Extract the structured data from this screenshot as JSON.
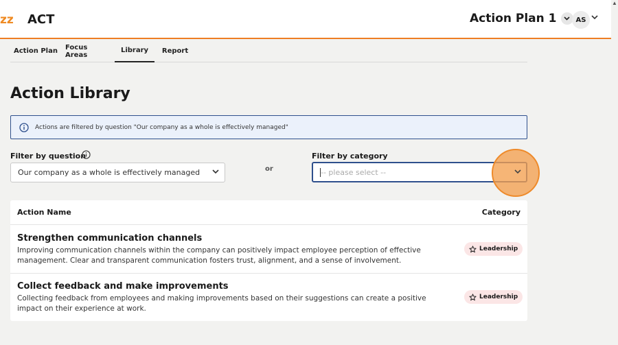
{
  "header": {
    "logo_text": "zz",
    "app_name": "ACT",
    "plan_name": "Action Plan 1",
    "user_initials": "AS"
  },
  "tabs": [
    {
      "label": "Action Plan",
      "active": false
    },
    {
      "label": "Focus Areas",
      "active": false
    },
    {
      "label": "Library",
      "active": true
    },
    {
      "label": "Report",
      "active": false
    }
  ],
  "page_title": "Action Library",
  "info_banner": {
    "text": "Actions are filtered by question \"Our company as a whole is effectively managed\""
  },
  "filters": {
    "question_label": "Filter by question",
    "question_selected": "Our company as a whole is effectively managed",
    "or_text": "or",
    "category_label": "Filter by category",
    "category_placeholder": "-- please select --"
  },
  "table": {
    "headers": {
      "name": "Action Name",
      "category": "Category"
    },
    "rows": [
      {
        "title": "Strengthen communication channels",
        "description": "Improving communication channels within the company can positively impact employee perception of effective management. Clear and transparent communication fosters trust, alignment, and a sense of involvement.",
        "category": "Leadership"
      },
      {
        "title": "Collect feedback and make improvements",
        "description": "Collecting feedback from employees and making improvements based on their suggestions can create a positive impact on their experience at work.",
        "category": "Leadership"
      }
    ]
  },
  "colors": {
    "accent": "#ee7d22",
    "focus_border": "#2e4f8c",
    "info_bg": "#ebf1fb",
    "badge_bg": "#fbe6e6"
  }
}
